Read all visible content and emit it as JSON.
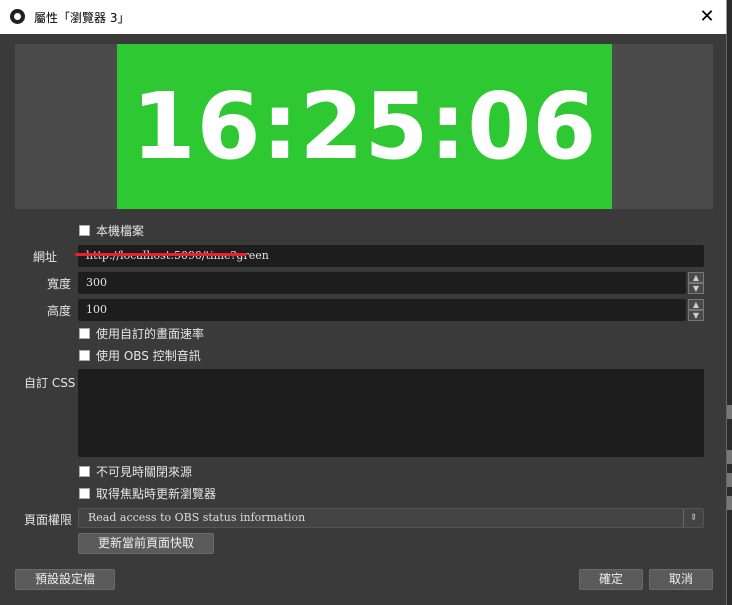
{
  "window": {
    "title": "屬性「瀏覽器 3」",
    "close_glyph": "✕"
  },
  "preview": {
    "time": "16:25:06",
    "bg_color": "#2ec932"
  },
  "fields": {
    "local_file_label": "本機檔案",
    "url_label": "網址",
    "url_value": "http://localhost:5090/time?green",
    "width_label": "寬度",
    "width_value": "300",
    "height_label": "高度",
    "height_value": "100",
    "custom_fps_label": "使用自訂的畫面速率",
    "obs_audio_label": "使用 OBS 控制音訊",
    "css_label": "自訂 CSS",
    "css_value": "",
    "shutdown_hidden_label": "不可見時關閉來源",
    "refresh_on_active_label": "取得焦點時更新瀏覽器",
    "permissions_label": "頁面權限",
    "permissions_value": "Read access to OBS status information",
    "refresh_cache_button": "更新當前頁面快取"
  },
  "footer": {
    "defaults_button": "預設設定檔",
    "ok_button": "確定",
    "cancel_button": "取消"
  },
  "colors": {
    "annotation_underline": "#e8212d"
  }
}
